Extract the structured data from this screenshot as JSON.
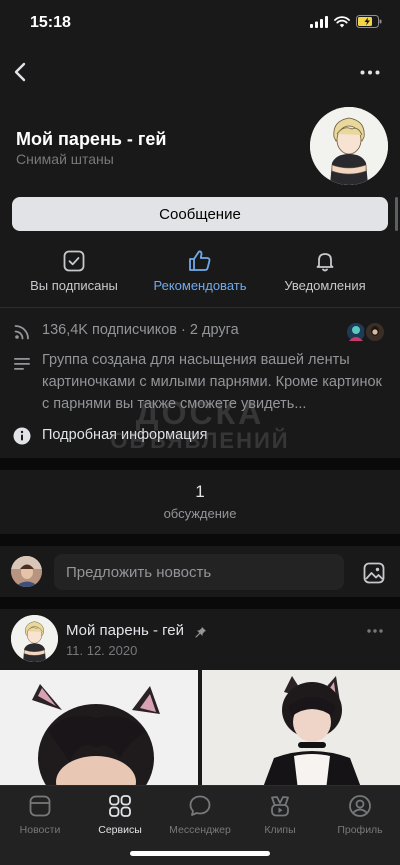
{
  "status_bar": {
    "time": "15:18"
  },
  "community": {
    "name": "Мой парень -  гей",
    "status": "Снимай штаны"
  },
  "message_button": "Сообщение",
  "actions": [
    {
      "label": "Вы подписаны",
      "icon": "checkbox-icon"
    },
    {
      "label": "Рекомендовать",
      "icon": "thumbs-up-icon"
    },
    {
      "label": "Уведомления",
      "icon": "bell-icon"
    }
  ],
  "info": {
    "subscribers": "136,4K подписчиков · 2 друга",
    "description": "Группа создана для насыщения вашей ленты картиночками с милыми парнями. Кроме картинок с парнями вы также сможете увидеть...",
    "more_info": "Подробная информация"
  },
  "watermark": {
    "line1": "ДОСКА",
    "line2": "ОБЪЯВЛЕНИЙ"
  },
  "discussions": {
    "count": "1",
    "label": "обсуждение"
  },
  "suggest": {
    "placeholder": "Предложить новость"
  },
  "post": {
    "author": "Мой парень -  гей",
    "date": "11. 12. 2020"
  },
  "tabs": [
    {
      "label": "Новости",
      "icon": "news-icon",
      "active": false
    },
    {
      "label": "Сервисы",
      "icon": "services-icon",
      "active": true
    },
    {
      "label": "Мессенджер",
      "icon": "messenger-icon",
      "active": false
    },
    {
      "label": "Клипы",
      "icon": "clips-icon",
      "active": false
    },
    {
      "label": "Профиль",
      "icon": "profile-icon",
      "active": false
    }
  ],
  "colors": {
    "background": "#19191a",
    "accent": "#71aaeb",
    "secondary_text": "#939598",
    "tab_bar": "#222223"
  }
}
